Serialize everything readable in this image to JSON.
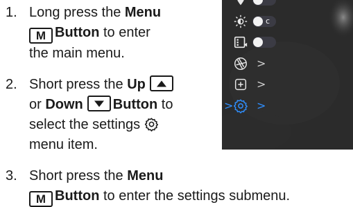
{
  "steps": [
    {
      "number": "1.",
      "line1": {
        "pre": "Long press the ",
        "bold": "Menu"
      },
      "line2": {
        "key": "M",
        "bold": "Button",
        "post": " to enter"
      },
      "line3": "the main menu."
    },
    {
      "number": "2.",
      "line1": {
        "pre": "Short press the ",
        "bold": "Up"
      },
      "line2": {
        "pre": "or ",
        "bold1": "Down",
        "bold2": "Button",
        "post": " to"
      },
      "line3": {
        "text": "select the settings"
      },
      "line4": "menu item."
    },
    {
      "number": "3.",
      "line1": {
        "pre": "Short press the ",
        "bold": "Menu"
      },
      "line2": {
        "key": "M",
        "bold": "Button",
        "post": " to enter the settings submenu."
      }
    }
  ],
  "device_menu": {
    "items": [
      {
        "icon": "location-icon",
        "type": "toggle",
        "label": ""
      },
      {
        "icon": "brightness-icon",
        "type": "toggle",
        "label": "c"
      },
      {
        "icon": "recording-icon",
        "type": "toggle",
        "label": ""
      },
      {
        "icon": "aperture-icon",
        "type": "submenu",
        "chevron": ">"
      },
      {
        "icon": "add-box-icon",
        "type": "submenu",
        "chevron": ">"
      },
      {
        "icon": "gear-icon",
        "type": "submenu",
        "chevron": ">",
        "selected": true,
        "selector": ">"
      }
    ]
  },
  "colors": {
    "text": "#1a1a1a",
    "screen_bg": "#2a2a2a",
    "accent": "#2f8fff",
    "toggle_track": "#3b3b44"
  }
}
